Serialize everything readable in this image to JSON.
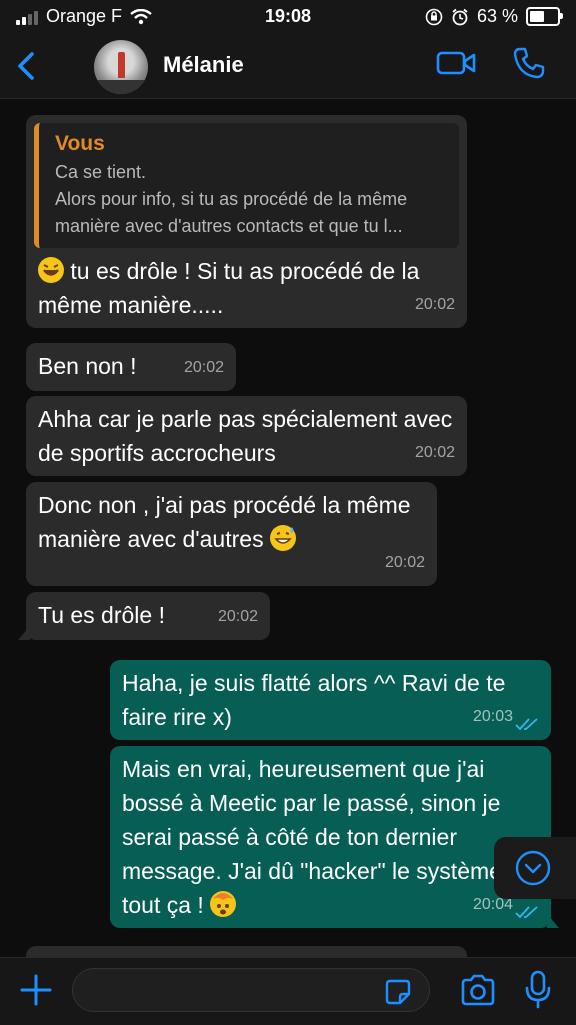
{
  "status_bar": {
    "carrier": "Orange F",
    "time": "19:08",
    "battery": "63 %",
    "battery_level": 0.63
  },
  "header": {
    "contact_name": "Mélanie"
  },
  "quote": {
    "author": "Vous",
    "text": "Ca se tient.\nAlors pour info, si tu as procédé de la même manière avec d'autres contacts et que tu l..."
  },
  "messages": [
    {
      "dir": "in",
      "text": "tu es drôle ! Si tu as procédé de la même manière.....",
      "time": "20:02",
      "emoji": "rolling-on-floor-laughing-emoji"
    },
    {
      "dir": "in",
      "text": "Ben non !",
      "time": "20:02"
    },
    {
      "dir": "in",
      "text": "Ahha car je parle pas spécialement avec de sportifs accrocheurs",
      "time": "20:02"
    },
    {
      "dir": "in",
      "text": "Donc non , j'ai pas procédé la même manière avec d'autres",
      "time": "20:02",
      "emoji": "grinning-sweat-emoji"
    },
    {
      "dir": "in",
      "text": "Tu es drôle !",
      "time": "20:02"
    },
    {
      "dir": "out",
      "text": "Haha, je suis flatté alors ^^ Ravi de te faire rire x)",
      "time": "20:03"
    },
    {
      "dir": "out",
      "text": "Mais en vrai, heureusement que j'ai bossé à Meetic par le passé, sinon je serai passé à côté de ton dernier message. J'ai dû \"hacker\" le système, tout ça !",
      "time": "20:04",
      "emoji": "exploding-head-emoji"
    }
  ],
  "input": {
    "placeholder": ""
  },
  "colors": {
    "accent": "#1f8fff",
    "incoming": "#2b2b2b",
    "outgoing": "#075e54",
    "quote_author": "#e08a2a"
  }
}
